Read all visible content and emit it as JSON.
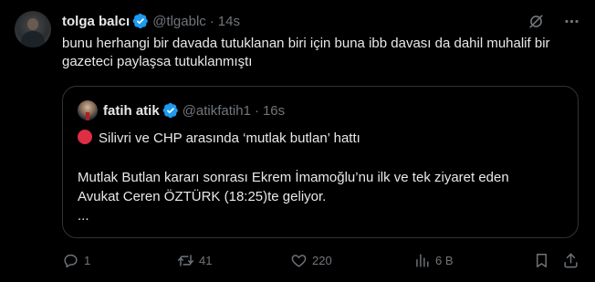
{
  "tweet": {
    "name": "tolga balcı",
    "handle": "@tlgablc",
    "separator": "·",
    "time": "14s",
    "text": "bunu herhangi bir davada tutuklanan biri için buna ibb davası da dahil muhalif bir gazeteci paylaşsa tutuklanmıştı",
    "icons": [
      "grok-icon",
      "more-icon"
    ]
  },
  "quote": {
    "name": "fatih atik",
    "handle": "@atikfatih1",
    "separator": "·",
    "time": "16s",
    "line1": "Silivri ve CHP arasında ‘mutlak butlan’ hattı",
    "line2": "Mutlak Butlan kararı sonrası Ekrem İmamoğlu’nu ilk ve tek ziyaret eden",
    "line3": "Avukat Ceren ÖZTÜRK (18:25)te geliyor.",
    "line4": "...",
    "emoji": "red-circle"
  },
  "actions": {
    "replies": "1",
    "reposts": "41",
    "likes": "220",
    "views": "6 B"
  },
  "colors": {
    "background": "#000000",
    "text": "#e7e9ea",
    "muted": "#71767b",
    "border": "#2f3336",
    "verified": "#1d9bf0"
  }
}
